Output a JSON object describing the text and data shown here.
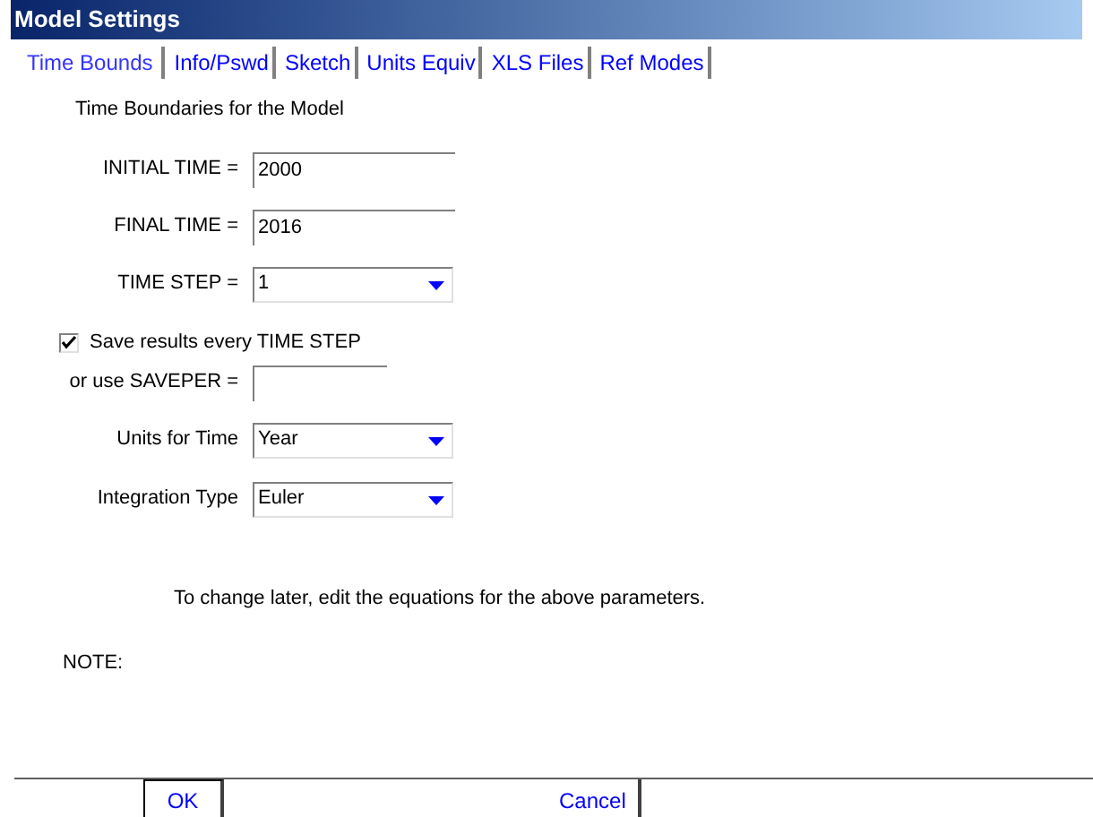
{
  "window": {
    "title": "Model Settings"
  },
  "tabs": [
    {
      "label": "Time Bounds",
      "selected": true
    },
    {
      "label": "Info/Pswd",
      "selected": false
    },
    {
      "label": "Sketch",
      "selected": false
    },
    {
      "label": "Units Equiv",
      "selected": false
    },
    {
      "label": "XLS Files",
      "selected": false
    },
    {
      "label": "Ref Modes",
      "selected": false
    }
  ],
  "heading": "Time Boundaries for the Model",
  "fields": [
    {
      "kind": "text",
      "label": "INITIAL TIME =",
      "value": "2000"
    },
    {
      "kind": "text",
      "label": "FINAL TIME =",
      "value": "2016"
    },
    {
      "kind": "dropdown",
      "label": "TIME STEP =",
      "value": "1"
    },
    {
      "kind": "checkbox",
      "label": "Save results every TIME STEP",
      "checked": true
    },
    {
      "kind": "short",
      "label": "or use SAVEPER ="
    },
    {
      "kind": "dropdown",
      "label": "Units for Time",
      "value": "Year"
    },
    {
      "kind": "dropdown",
      "label": "Integration Type",
      "value": "Euler"
    }
  ],
  "hint": "To change later, edit the equations for the above parameters.",
  "note_label": "NOTE:",
  "buttons": [
    {
      "label": "OK",
      "kind": "default"
    },
    {
      "label": "Cancel",
      "kind": "plain"
    }
  ]
}
